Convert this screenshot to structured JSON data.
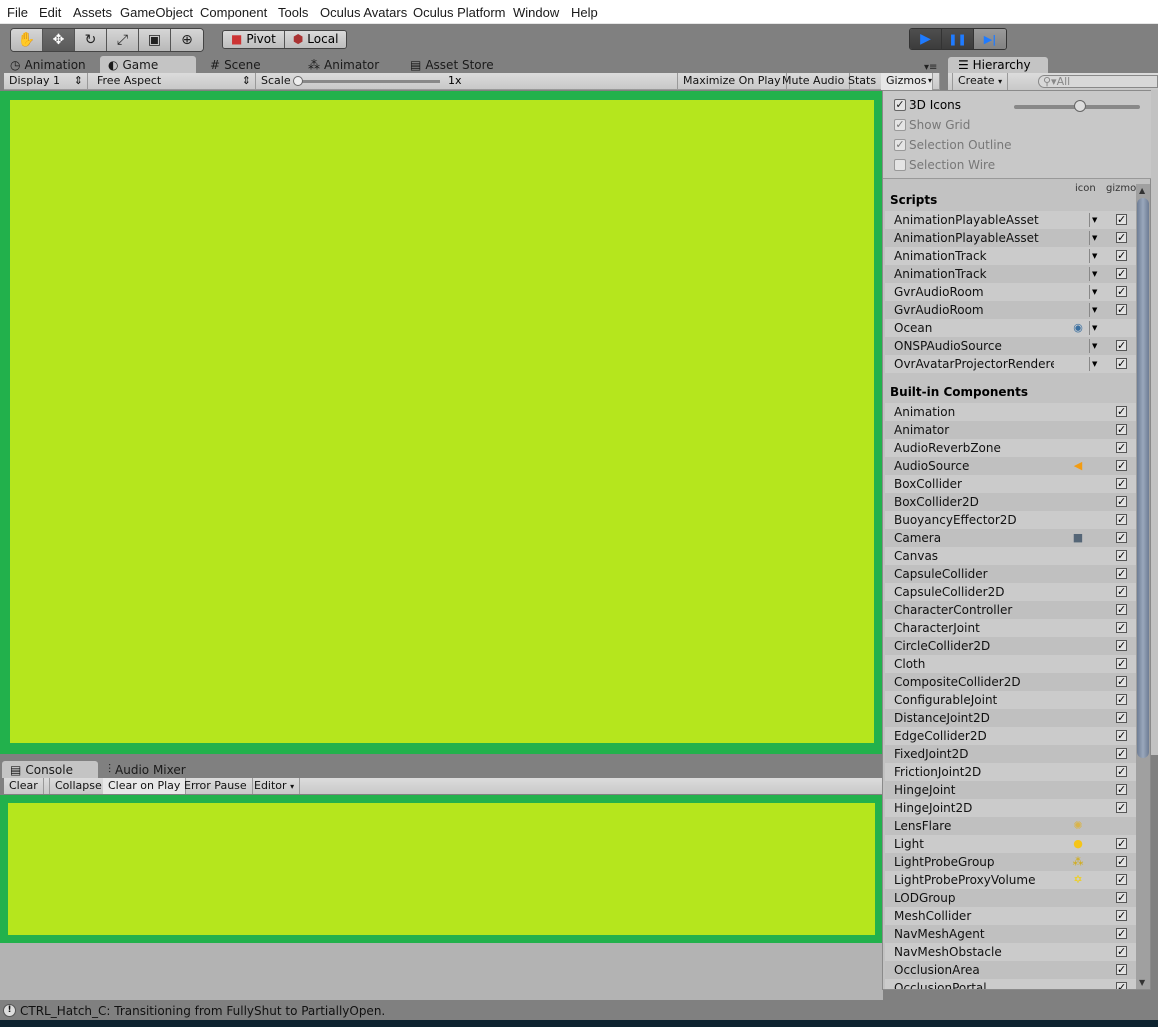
{
  "menubar": [
    "File",
    "Edit",
    "Assets",
    "GameObject",
    "Component",
    "Tools",
    "Oculus Avatars",
    "Oculus Platform",
    "Window",
    "Help"
  ],
  "toolbar": {
    "tools": [
      {
        "name": "hand-tool",
        "glyph": "✋"
      },
      {
        "name": "move-tool",
        "glyph": "✥"
      },
      {
        "name": "rotate-tool",
        "glyph": "↻"
      },
      {
        "name": "scale-tool",
        "glyph": "⤢"
      },
      {
        "name": "rect-tool",
        "glyph": "▣"
      },
      {
        "name": "transform-tool",
        "glyph": "⊕"
      }
    ],
    "pivot_label": "Pivot",
    "local_label": "Local",
    "play": "▶",
    "pause": "❚❚",
    "step": "▶|"
  },
  "tabs": {
    "animation": "Animation",
    "game": "Game",
    "scene": "Scene",
    "animator": "Animator",
    "asset_store": "Asset Store",
    "hierarchy": "Hierarchy"
  },
  "gamebar": {
    "display": "Display 1",
    "aspect": "Free Aspect",
    "scale_label": "Scale",
    "scale_value": "1x",
    "maximize": "Maximize On Play",
    "mute": "Mute Audio",
    "stats": "Stats",
    "gizmos": "Gizmos"
  },
  "hierarchy": {
    "create": "Create",
    "search_placeholder": "All"
  },
  "gizmos_menu": {
    "options": [
      {
        "label": "3D Icons",
        "checked": true,
        "enabled": true
      },
      {
        "label": "Show Grid",
        "checked": true,
        "enabled": false
      },
      {
        "label": "Selection Outline",
        "checked": true,
        "enabled": false
      },
      {
        "label": "Selection Wire",
        "checked": false,
        "enabled": false
      }
    ],
    "icon_size_slider": 0.5,
    "col_icon": "icon",
    "col_gizmo": "gizmo",
    "scripts_header": "Scripts",
    "scripts": [
      {
        "name": "AnimationPlayableAsset",
        "icon": "",
        "dropdown": true,
        "gizmo": true
      },
      {
        "name": "AnimationPlayableAsset",
        "icon": "",
        "dropdown": true,
        "gizmo": true
      },
      {
        "name": "AnimationTrack",
        "icon": "",
        "dropdown": true,
        "gizmo": true
      },
      {
        "name": "AnimationTrack",
        "icon": "",
        "dropdown": true,
        "gizmo": true
      },
      {
        "name": "GvrAudioRoom",
        "icon": "",
        "dropdown": true,
        "gizmo": true
      },
      {
        "name": "GvrAudioRoom",
        "icon": "",
        "dropdown": true,
        "gizmo": true
      },
      {
        "name": "Ocean",
        "icon": "ocean-icon",
        "dropdown": true,
        "gizmo": false
      },
      {
        "name": "ONSPAudioSource",
        "icon": "",
        "dropdown": true,
        "gizmo": true
      },
      {
        "name": "OvrAvatarProjectorRenderer",
        "icon": "",
        "dropdown": true,
        "gizmo": true
      }
    ],
    "builtin_header": "Built-in Components",
    "builtin": [
      {
        "name": "Animation",
        "icon": "",
        "gizmo": true
      },
      {
        "name": "Animator",
        "icon": "",
        "gizmo": true
      },
      {
        "name": "AudioReverbZone",
        "icon": "",
        "gizmo": true
      },
      {
        "name": "AudioSource",
        "icon": "speaker-icon",
        "gizmo": true
      },
      {
        "name": "BoxCollider",
        "icon": "",
        "gizmo": true
      },
      {
        "name": "BoxCollider2D",
        "icon": "",
        "gizmo": true
      },
      {
        "name": "BuoyancyEffector2D",
        "icon": "",
        "gizmo": true
      },
      {
        "name": "Camera",
        "icon": "camera-icon",
        "gizmo": true
      },
      {
        "name": "Canvas",
        "icon": "",
        "gizmo": true
      },
      {
        "name": "CapsuleCollider",
        "icon": "",
        "gizmo": true
      },
      {
        "name": "CapsuleCollider2D",
        "icon": "",
        "gizmo": true
      },
      {
        "name": "CharacterController",
        "icon": "",
        "gizmo": true
      },
      {
        "name": "CharacterJoint",
        "icon": "",
        "gizmo": true
      },
      {
        "name": "CircleCollider2D",
        "icon": "",
        "gizmo": true
      },
      {
        "name": "Cloth",
        "icon": "",
        "gizmo": true
      },
      {
        "name": "CompositeCollider2D",
        "icon": "",
        "gizmo": true
      },
      {
        "name": "ConfigurableJoint",
        "icon": "",
        "gizmo": true
      },
      {
        "name": "DistanceJoint2D",
        "icon": "",
        "gizmo": true
      },
      {
        "name": "EdgeCollider2D",
        "icon": "",
        "gizmo": true
      },
      {
        "name": "FixedJoint2D",
        "icon": "",
        "gizmo": true
      },
      {
        "name": "FrictionJoint2D",
        "icon": "",
        "gizmo": true
      },
      {
        "name": "HingeJoint",
        "icon": "",
        "gizmo": true
      },
      {
        "name": "HingeJoint2D",
        "icon": "",
        "gizmo": true
      },
      {
        "name": "LensFlare",
        "icon": "lens-flare-icon",
        "gizmo": false
      },
      {
        "name": "Light",
        "icon": "light-bulb-icon",
        "gizmo": true
      },
      {
        "name": "LightProbeGroup",
        "icon": "light-probe-icon",
        "gizmo": true
      },
      {
        "name": "LightProbeProxyVolume",
        "icon": "probe-volume-icon",
        "gizmo": true
      },
      {
        "name": "LODGroup",
        "icon": "",
        "gizmo": true
      },
      {
        "name": "MeshCollider",
        "icon": "",
        "gizmo": true
      },
      {
        "name": "NavMeshAgent",
        "icon": "",
        "gizmo": true
      },
      {
        "name": "NavMeshObstacle",
        "icon": "",
        "gizmo": true
      },
      {
        "name": "OcclusionArea",
        "icon": "",
        "gizmo": true
      },
      {
        "name": "OcclusionPortal",
        "icon": "",
        "gizmo": true
      }
    ]
  },
  "console": {
    "tab": "Console",
    "audio_mixer_tab": "Audio Mixer",
    "buttons": [
      {
        "label": "Clear",
        "on": false
      },
      {
        "label": "Collapse",
        "on": false
      },
      {
        "label": "Clear on Play",
        "on": true
      },
      {
        "label": "Error Pause",
        "on": false
      },
      {
        "label": "Editor",
        "on": false
      }
    ]
  },
  "status": {
    "message": "CTRL_Hatch_C: Transitioning from FullyShut to PartiallyOpen."
  },
  "colors": {
    "game_border": "#22b14c",
    "game_fill": "#b5e61d",
    "play_accent": "#1f7bff"
  }
}
